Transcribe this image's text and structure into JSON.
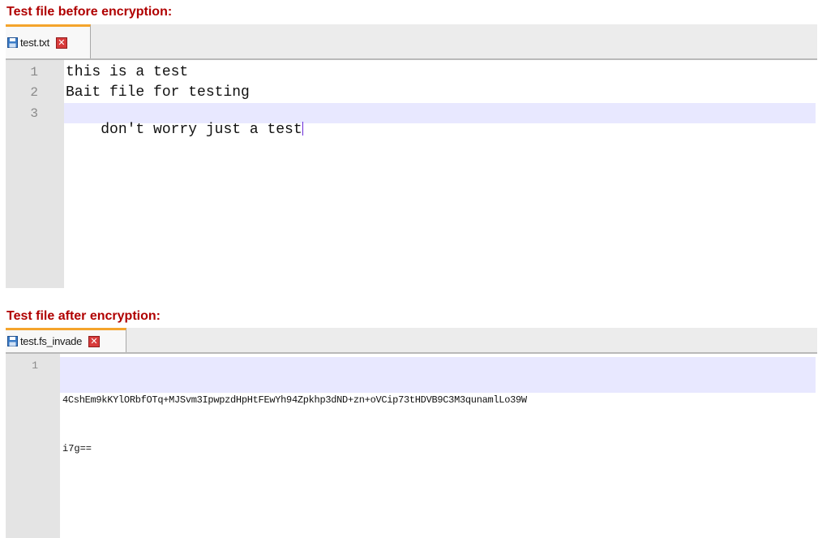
{
  "before": {
    "caption": "Test file before encryption:",
    "tab_label": "test.txt",
    "line_numbers": [
      "1",
      "2",
      "3"
    ],
    "lines": [
      "this is a test",
      "Bait file for testing",
      "don't worry just a test"
    ]
  },
  "after": {
    "caption": "Test file after encryption:",
    "tab_label": "test.fs_invade",
    "line_numbers": [
      "1"
    ],
    "lines": [
      "4CshEm9kKYlORbfOTq+MJSvm3IpwpzdHpHtFEwYh94Zpkhp3dND+zn+oVCip73tHDVB9C3M3qunamlLo39W",
      "i7g=="
    ]
  },
  "icons": {
    "file": "save-disk-icon",
    "close": "close-x-icon"
  },
  "colors": {
    "caption": "#b00000",
    "active_tab_accent": "#f4a42c",
    "current_line_highlight": "#e8e8ff",
    "gutter": "#e4e4e4",
    "caret": "#6a2bd9",
    "close_button": "#d83b3b"
  }
}
